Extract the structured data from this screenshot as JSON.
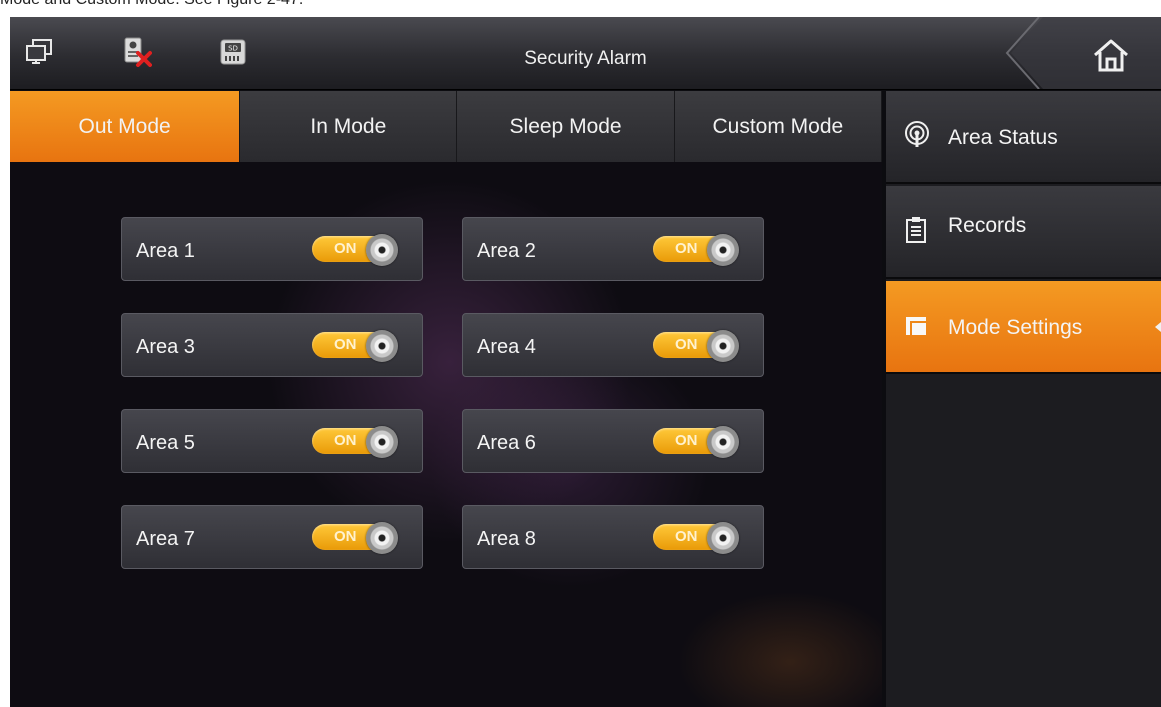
{
  "caption": "Mode and Custom Mode. See Figure 2-47.",
  "app": {
    "title": "Security Alarm",
    "accent": "#f0861a"
  },
  "top_icons": [
    "monitor-icon",
    "door-station-offline-icon",
    "sd-card-icon"
  ],
  "tabs": [
    {
      "label": "Out Mode",
      "active": true
    },
    {
      "label": "In Mode",
      "active": false
    },
    {
      "label": "Sleep Mode",
      "active": false
    },
    {
      "label": "Custom Mode",
      "active": false
    }
  ],
  "areas": [
    {
      "label": "Area 1",
      "toggle": "ON"
    },
    {
      "label": "Area 2",
      "toggle": "ON"
    },
    {
      "label": "Area 3",
      "toggle": "ON"
    },
    {
      "label": "Area 4",
      "toggle": "ON"
    },
    {
      "label": "Area 5",
      "toggle": "ON"
    },
    {
      "label": "Area 6",
      "toggle": "ON"
    },
    {
      "label": "Area 7",
      "toggle": "ON"
    },
    {
      "label": "Area 8",
      "toggle": "ON"
    }
  ],
  "sidebar": {
    "items": [
      {
        "label": "Area Status",
        "icon": "broadcast-icon",
        "active": false
      },
      {
        "label": "Records",
        "icon": "clipboard-icon",
        "active": false
      },
      {
        "label": "Mode Settings",
        "icon": "layers-icon",
        "active": true
      }
    ]
  }
}
